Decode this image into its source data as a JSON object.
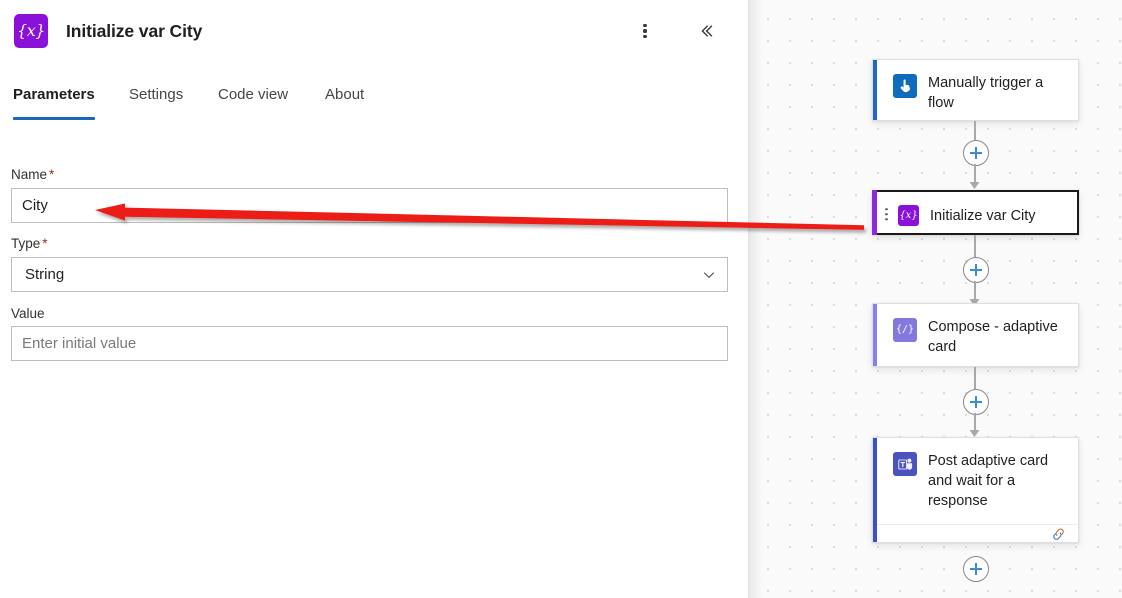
{
  "panel": {
    "icon_name": "variable-braces-icon",
    "icon_glyph": "{x}",
    "icon_color": "#8a11d9",
    "title": "Initialize var City",
    "actions": {
      "more_icon": "more-vertical-icon",
      "collapse_icon": "chevron-double-left-icon"
    },
    "tabs": [
      {
        "label": "Parameters",
        "active": true
      },
      {
        "label": "Settings",
        "active": false
      },
      {
        "label": "Code view",
        "active": false
      },
      {
        "label": "About",
        "active": false
      }
    ],
    "active_tab_color": "#1668b8",
    "fields": [
      {
        "label": "Name",
        "required": true,
        "required_marker": "*",
        "kind": "text",
        "value": "City",
        "placeholder": ""
      },
      {
        "label": "Type",
        "required": true,
        "required_marker": "*",
        "kind": "select",
        "value": "String",
        "placeholder": "",
        "chevron_icon": "chevron-down-icon"
      },
      {
        "label": "Value",
        "required": false,
        "required_marker": "",
        "kind": "text",
        "value": "",
        "placeholder": "Enter initial value"
      }
    ]
  },
  "annotation": {
    "type": "arrow",
    "color": "#ec1c17",
    "points_to": "Name field",
    "description": "red arrow pointing left to the Name input"
  },
  "canvas": {
    "background_color": "#fafafa",
    "nodes": [
      {
        "label": "Manually trigger a flow",
        "icon_name": "manual-trigger-icon",
        "icon_color": "#0f6cbd",
        "accent_color": "#2266cc",
        "selected": false,
        "has_footer": false
      },
      {
        "label": "Initialize var City",
        "icon_name": "variable-braces-icon",
        "icon_glyph": "{x}",
        "icon_color": "#8a11d9",
        "accent_color": "#8a2be2",
        "selected": true,
        "has_footer": false,
        "handle_icon": "drag-handle-dots-icon"
      },
      {
        "label": "Compose - adaptive card",
        "icon_name": "compose-icon",
        "icon_glyph": "{/}",
        "icon_color": "#8378de",
        "accent_color": "#8a7ff0",
        "selected": false,
        "has_footer": false
      },
      {
        "label": "Post adaptive card and wait for a response",
        "icon_name": "microsoft-teams-icon",
        "icon_color": "#4b53bc",
        "accent_color": "#3a52c7",
        "selected": false,
        "has_footer": true,
        "footer_icon": "connection-link-icon"
      }
    ],
    "add_buttons": [
      {
        "name": "add-step-after-trigger",
        "icon": "plus-icon"
      },
      {
        "name": "add-step-after-initialize-variable",
        "icon": "plus-icon"
      },
      {
        "name": "add-step-after-compose",
        "icon": "plus-icon"
      },
      {
        "name": "add-step-after-post-adaptive-card",
        "icon": "plus-icon"
      }
    ]
  }
}
